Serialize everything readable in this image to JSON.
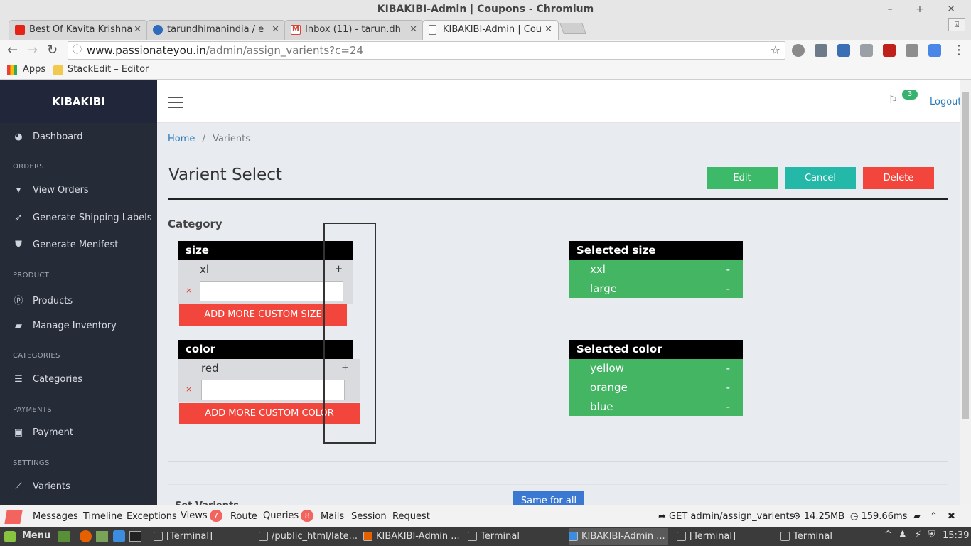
{
  "window": {
    "title": "KIBAKIBI-Admin | Coupons - Chromium",
    "controls": "– + ✕"
  },
  "tabs": [
    {
      "label": "Best Of Kavita Krishna",
      "icon": "youtube-icon",
      "color": "#e62117"
    },
    {
      "label": "tarundhimanindia / e",
      "icon": "github-icon",
      "color": "#2d6bbd"
    },
    {
      "label": "Inbox (11) - tarun.dh",
      "icon": "gmail-icon",
      "color": "#d44638"
    },
    {
      "label": "KIBAKIBI-Admin | Cou",
      "icon": "page-icon",
      "color": "#777777"
    }
  ],
  "url": {
    "host": "www.passionateyou.in",
    "path": "/admin/assign_varients?c=24"
  },
  "bookmarks": {
    "apps": "Apps",
    "stackedit": "StackEdit – Editor"
  },
  "sidebar": {
    "brand": "KIBAKIBI",
    "dashboard": "Dashboard",
    "h_orders": "ORDERS",
    "view_orders": "View Orders",
    "shipping": "Generate Shipping Labels",
    "manifest": "Generate Menifest",
    "h_product": "PRODUCT",
    "products": "Products",
    "inventory": "Manage Inventory",
    "h_categories": "CATEGORIES",
    "categories": "Categories",
    "h_payments": "PAYMENTS",
    "payment": "Payment",
    "h_settings": "SETTINGS",
    "varients": "Varients"
  },
  "header": {
    "notif_count": "3",
    "logout": "Logout"
  },
  "breadcrumb": {
    "home": "Home",
    "sep": "/",
    "current": "Varients"
  },
  "page": {
    "title": "Varient Select",
    "edit": "Edit",
    "cancel": "Cancel",
    "delete": "Delete",
    "category": "Category",
    "set_varients": "Set Varients",
    "same_for_all": "Same for all"
  },
  "size_box": {
    "title": "size",
    "option": "xl",
    "plus": "+",
    "remove": "×",
    "add": "ADD MORE CUSTOM SIZE"
  },
  "color_box": {
    "title": "color",
    "option": "red",
    "plus": "+",
    "remove": "×",
    "add": "ADD MORE CUSTOM COLOR"
  },
  "selected_size": {
    "title": "Selected size",
    "items": [
      "xxl",
      "large"
    ],
    "minus": "-"
  },
  "selected_color": {
    "title": "Selected color",
    "items": [
      "yellow",
      "orange",
      "blue"
    ],
    "minus": "-"
  },
  "colors": {
    "edit": "#3dba69",
    "cancel": "#23b8a8",
    "delete": "#f2453c",
    "selected": "#44b562"
  },
  "debugbar": {
    "messages": "Messages",
    "timeline": "Timeline",
    "exceptions": "Exceptions",
    "views": "Views",
    "views_count": "7",
    "route": "Route",
    "queries": "Queries",
    "queries_count": "8",
    "mails": "Mails",
    "session": "Session",
    "request": "Request",
    "req_route": "GET admin/assign_varients",
    "memory": "14.25MB",
    "time": "159.66ms"
  },
  "taskbar": {
    "menu": "Menu",
    "tasks": [
      "[Terminal]",
      "/public_html/late...",
      "KIBAKIBI-Admin ...",
      "Terminal",
      "KIBAKIBI-Admin ...",
      "[Terminal]",
      "Terminal"
    ],
    "clock": "15:39"
  }
}
